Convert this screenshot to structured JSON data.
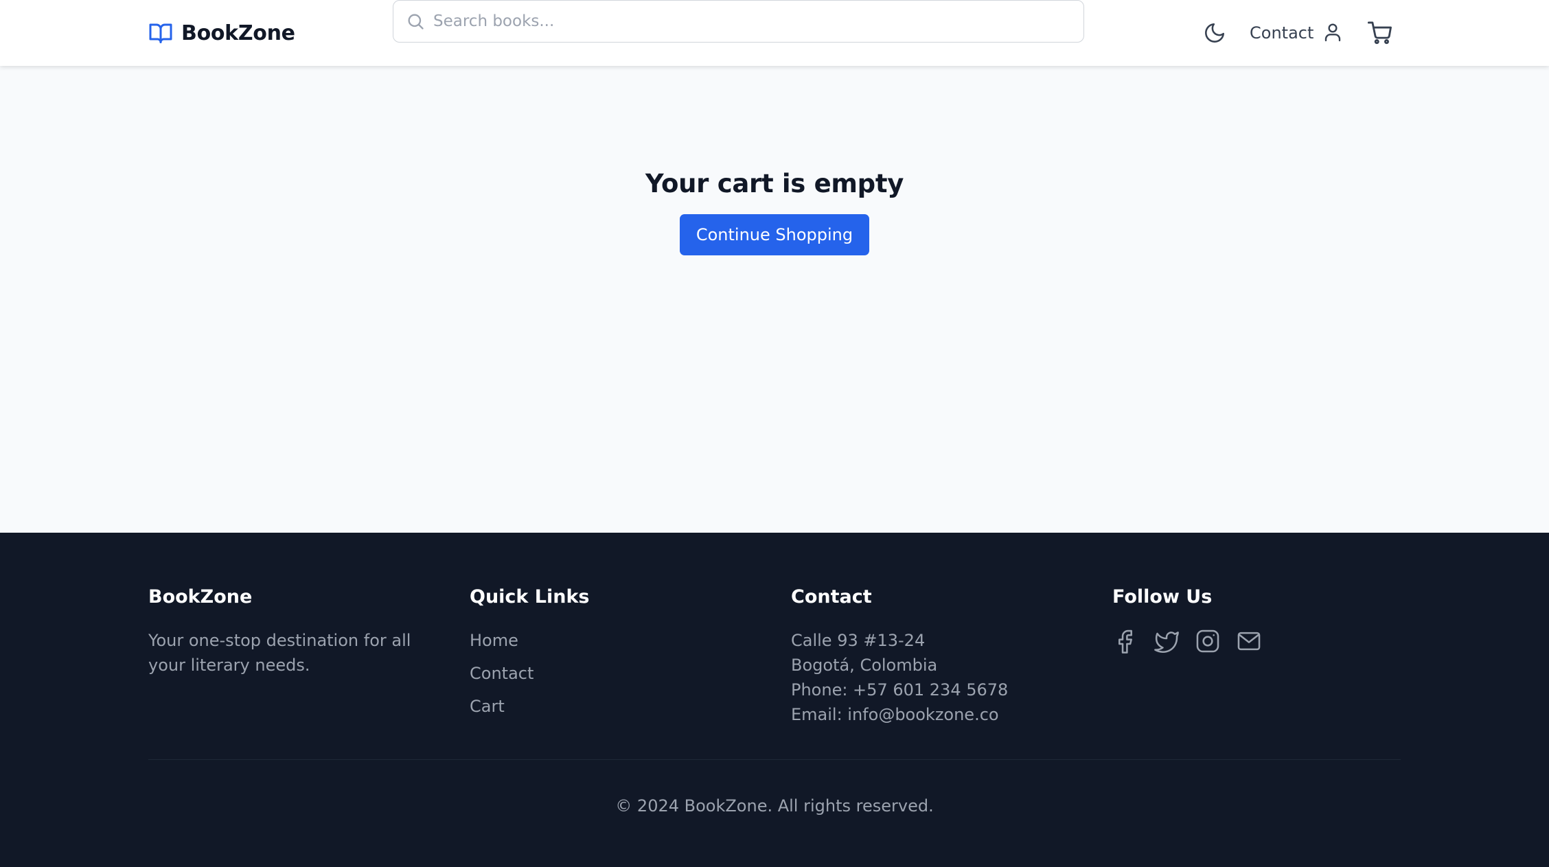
{
  "header": {
    "brand": "BookZone",
    "search_placeholder": "Search books...",
    "contact_label": "Contact",
    "icons": [
      "book-open-icon",
      "search-icon",
      "moon-icon",
      "user-icon",
      "cart-icon"
    ]
  },
  "main": {
    "title": "Your cart is empty",
    "button_label": "Continue Shopping"
  },
  "footer": {
    "brand": {
      "title": "BookZone",
      "description": "Your one-stop destination for all your literary needs."
    },
    "quick_links": {
      "title": "Quick Links",
      "items": [
        "Home",
        "Contact",
        "Cart"
      ]
    },
    "contact": {
      "title": "Contact",
      "address1": "Calle 93 #13-24",
      "address2": "Bogotá, Colombia",
      "phone": "Phone: +57 601 234 5678",
      "email": "Email: info@bookzone.co"
    },
    "follow": {
      "title": "Follow Us",
      "icons": [
        "facebook-icon",
        "twitter-icon",
        "instagram-icon",
        "mail-icon"
      ]
    },
    "copyright": "© 2024 BookZone. All rights reserved."
  },
  "colors": {
    "accent": "#2563eb",
    "footer_bg": "#111827",
    "page_bg": "#f8fafc"
  }
}
